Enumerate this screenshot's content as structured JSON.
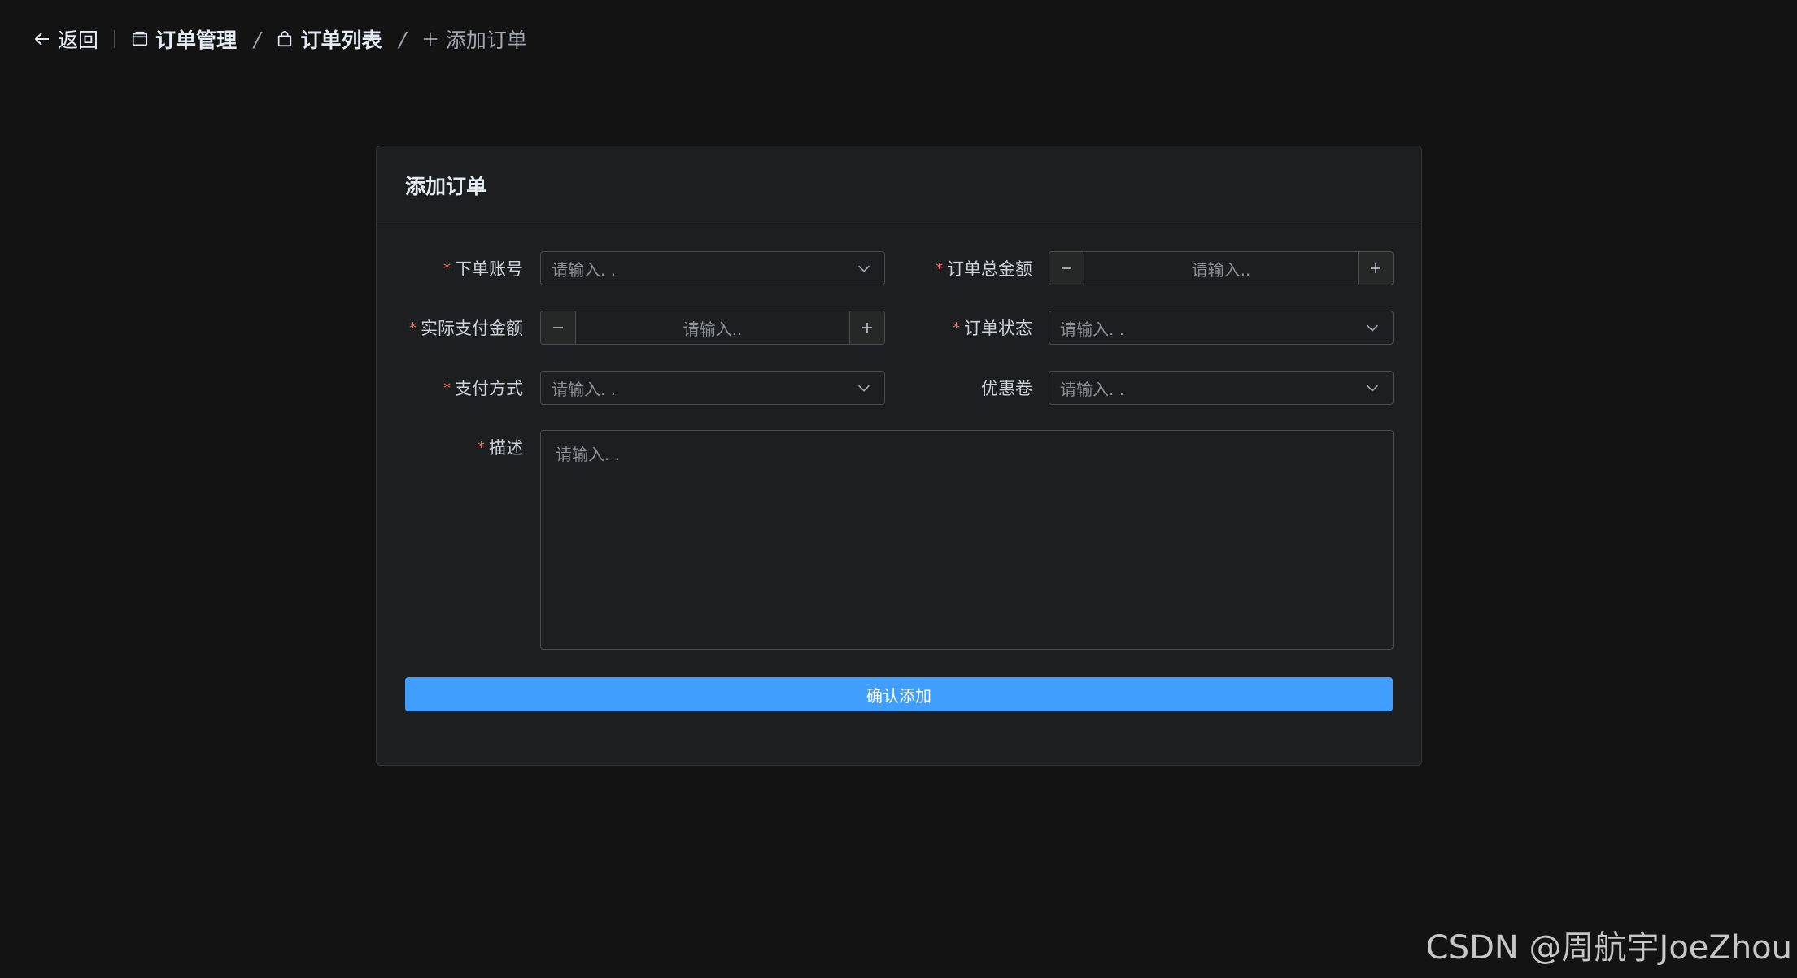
{
  "header": {
    "back_label": "返回",
    "breadcrumbs": [
      {
        "label": "订单管理",
        "icon": "box-icon"
      },
      {
        "label": "订单列表",
        "icon": "bag-icon"
      },
      {
        "label": "添加订单",
        "icon": "plus-icon"
      }
    ],
    "separator": "/"
  },
  "card": {
    "title": "添加订单"
  },
  "form": {
    "account": {
      "label": "下单账号",
      "required": true,
      "placeholder": "请输入. ."
    },
    "total_amount": {
      "label": "订单总金额",
      "required": true,
      "placeholder": "请输入.."
    },
    "paid_amount": {
      "label": "实际支付金额",
      "required": true,
      "placeholder": "请输入.."
    },
    "status": {
      "label": "订单状态",
      "required": true,
      "placeholder": "请输入. ."
    },
    "payment_method": {
      "label": "支付方式",
      "required": true,
      "placeholder": "请输入. ."
    },
    "coupon": {
      "label": "优惠卷",
      "required": false,
      "placeholder": "请输入. ."
    },
    "description": {
      "label": "描述",
      "required": true,
      "placeholder": "请输入. ."
    },
    "required_mark": "*",
    "submit_label": "确认添加"
  },
  "watermark": "CSDN @周航宇JoeZhou",
  "colors": {
    "background": "#131314",
    "card": "#1d1e1f",
    "primary": "#409eff",
    "required": "#f56c6c"
  }
}
